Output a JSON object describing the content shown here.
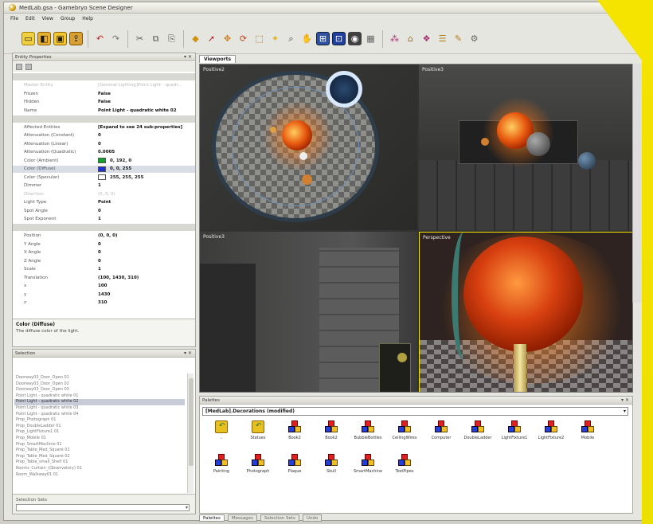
{
  "window": {
    "title": "MedLab.gsa - Gamebryo Scene Designer"
  },
  "menu": [
    "File",
    "Edit",
    "View",
    "Group",
    "Help"
  ],
  "toolbar": {
    "icons": [
      "new-icon",
      "open-icon",
      "save-icon",
      "export-icon",
      "undo-icon",
      "redo-icon",
      "cut-icon",
      "copy-icon",
      "paste-icon",
      "snap-icon",
      "select-icon",
      "move-icon",
      "rotate-icon",
      "scale-icon",
      "light-icon",
      "zoom-icon",
      "pan-icon",
      "zoom-extents-icon",
      "zoom-selected-icon",
      "camera-icon",
      "render-icon",
      "grid-icon",
      "scene-icon",
      "palette-icon",
      "layer-icon",
      "script-icon",
      "settings-icon"
    ]
  },
  "entity_properties": {
    "title": "Entity Properties",
    "rows": [
      {
        "kind": "cat",
        "name": "",
        "value": ""
      },
      {
        "kind": "dim",
        "name": "Master Entity",
        "value": "[General Lighting]Point Light - quadr..."
      },
      {
        "kind": "row",
        "name": "Frozen",
        "value": "False"
      },
      {
        "kind": "row",
        "name": "Hidden",
        "value": "False"
      },
      {
        "kind": "row",
        "name": "Name",
        "value": "Point Light - quadratic white 02"
      },
      {
        "kind": "cat",
        "name": "",
        "value": ""
      },
      {
        "kind": "row",
        "name": "Affected Entities",
        "value": "[Expand to see 24 sub-properties]"
      },
      {
        "kind": "row",
        "name": "Attenuation (Constant)",
        "value": "0"
      },
      {
        "kind": "row",
        "name": "Attenuation (Linear)",
        "value": "0"
      },
      {
        "kind": "row",
        "name": "Attenuation (Quadratic)",
        "value": "0.0005"
      },
      {
        "kind": "color",
        "name": "Color (Ambient)",
        "value": "0, 192, 0",
        "swatch": "#10a030"
      },
      {
        "kind": "color-sel",
        "name": "Color (Diffuse)",
        "value": "0, 0, 255",
        "swatch": "#2030d0"
      },
      {
        "kind": "color",
        "name": "Color (Specular)",
        "value": "255, 255, 255",
        "swatch": "#ffffff"
      },
      {
        "kind": "row",
        "name": "Dimmer",
        "value": "1"
      },
      {
        "kind": "dim",
        "name": "Direction",
        "value": "(0, 0, 0)"
      },
      {
        "kind": "row",
        "name": "Light Type",
        "value": "Point"
      },
      {
        "kind": "row",
        "name": "Spot Angle",
        "value": "0"
      },
      {
        "kind": "row",
        "name": "Spot Exponent",
        "value": "1"
      },
      {
        "kind": "cat",
        "name": "",
        "value": ""
      },
      {
        "kind": "row",
        "name": "Position",
        "value": "(0, 0, 0)"
      },
      {
        "kind": "row",
        "name": "Y Angle",
        "value": "0"
      },
      {
        "kind": "row",
        "name": "X Angle",
        "value": "0"
      },
      {
        "kind": "row",
        "name": "Z Angle",
        "value": "0"
      },
      {
        "kind": "row",
        "name": "Scale",
        "value": "1"
      },
      {
        "kind": "row",
        "name": "Translation",
        "value": "(100, 1430, 310)"
      },
      {
        "kind": "row",
        "name": "x",
        "value": "100"
      },
      {
        "kind": "row",
        "name": "y",
        "value": "1430"
      },
      {
        "kind": "row",
        "name": "z",
        "value": "310"
      }
    ],
    "description": {
      "title": "Color (Diffuse)",
      "text": "The diffuse color of the light."
    }
  },
  "selection": {
    "title": "Selection",
    "items": [
      "Doorway03_Door_Open 01",
      "Doorway03_Door_Open 02",
      "Doorway03_Door_Open 03",
      "Point Light - quadratic white 01",
      "Point Light - quadratic white 02",
      "Point Light - quadratic white 03",
      "Point Light - quadratic white 04",
      "Prop_Photograph 01",
      "Prop_DoubleLadder 01",
      "Prop_LightFixture1 01",
      "Prop_Mobile 01",
      "Prop_SmartMachine 01",
      "Prop_Table_Med_Square 01",
      "Prop_Table_Med_Square 02",
      "Prop_Table_small_Shelf 01",
      "Rooms_Curtain_(Observatory) 01",
      "Room_Walkway01 01"
    ],
    "selected_index": 4,
    "sets_label": "Selection Sets"
  },
  "viewports": {
    "tab": "Viewports",
    "labels": [
      "Positive2",
      "Positive3",
      "Positive3",
      "Perspective"
    ]
  },
  "palettes": {
    "title": "Palettes",
    "current": "[MedLab].Decorations (modified)",
    "items": [
      {
        "label": "..",
        "icon": "folder"
      },
      {
        "label": "Statues",
        "icon": "folder"
      },
      {
        "label": "Book2",
        "icon": "blocks"
      },
      {
        "label": "Book2",
        "icon": "blocks"
      },
      {
        "label": "BubbleBottles",
        "icon": "blocks"
      },
      {
        "label": "CeilingWires",
        "icon": "blocks"
      },
      {
        "label": "Computer",
        "icon": "blocks"
      },
      {
        "label": "DoubleLadder",
        "icon": "blocks"
      },
      {
        "label": "LightFixture1",
        "icon": "blocks"
      },
      {
        "label": "LightFixture2",
        "icon": "blocks"
      },
      {
        "label": "Mobile",
        "icon": "blocks"
      },
      {
        "label": "Painting",
        "icon": "blocks"
      },
      {
        "label": "Photograph",
        "icon": "blocks"
      },
      {
        "label": "Plaque",
        "icon": "blocks"
      },
      {
        "label": "Skull",
        "icon": "blocks"
      },
      {
        "label": "SmartMachine",
        "icon": "blocks"
      },
      {
        "label": "TestPipes",
        "icon": "blocks"
      }
    ]
  },
  "bottom_tabs": [
    "Palettes",
    "Messages",
    "Selection Sets",
    "Undo"
  ]
}
